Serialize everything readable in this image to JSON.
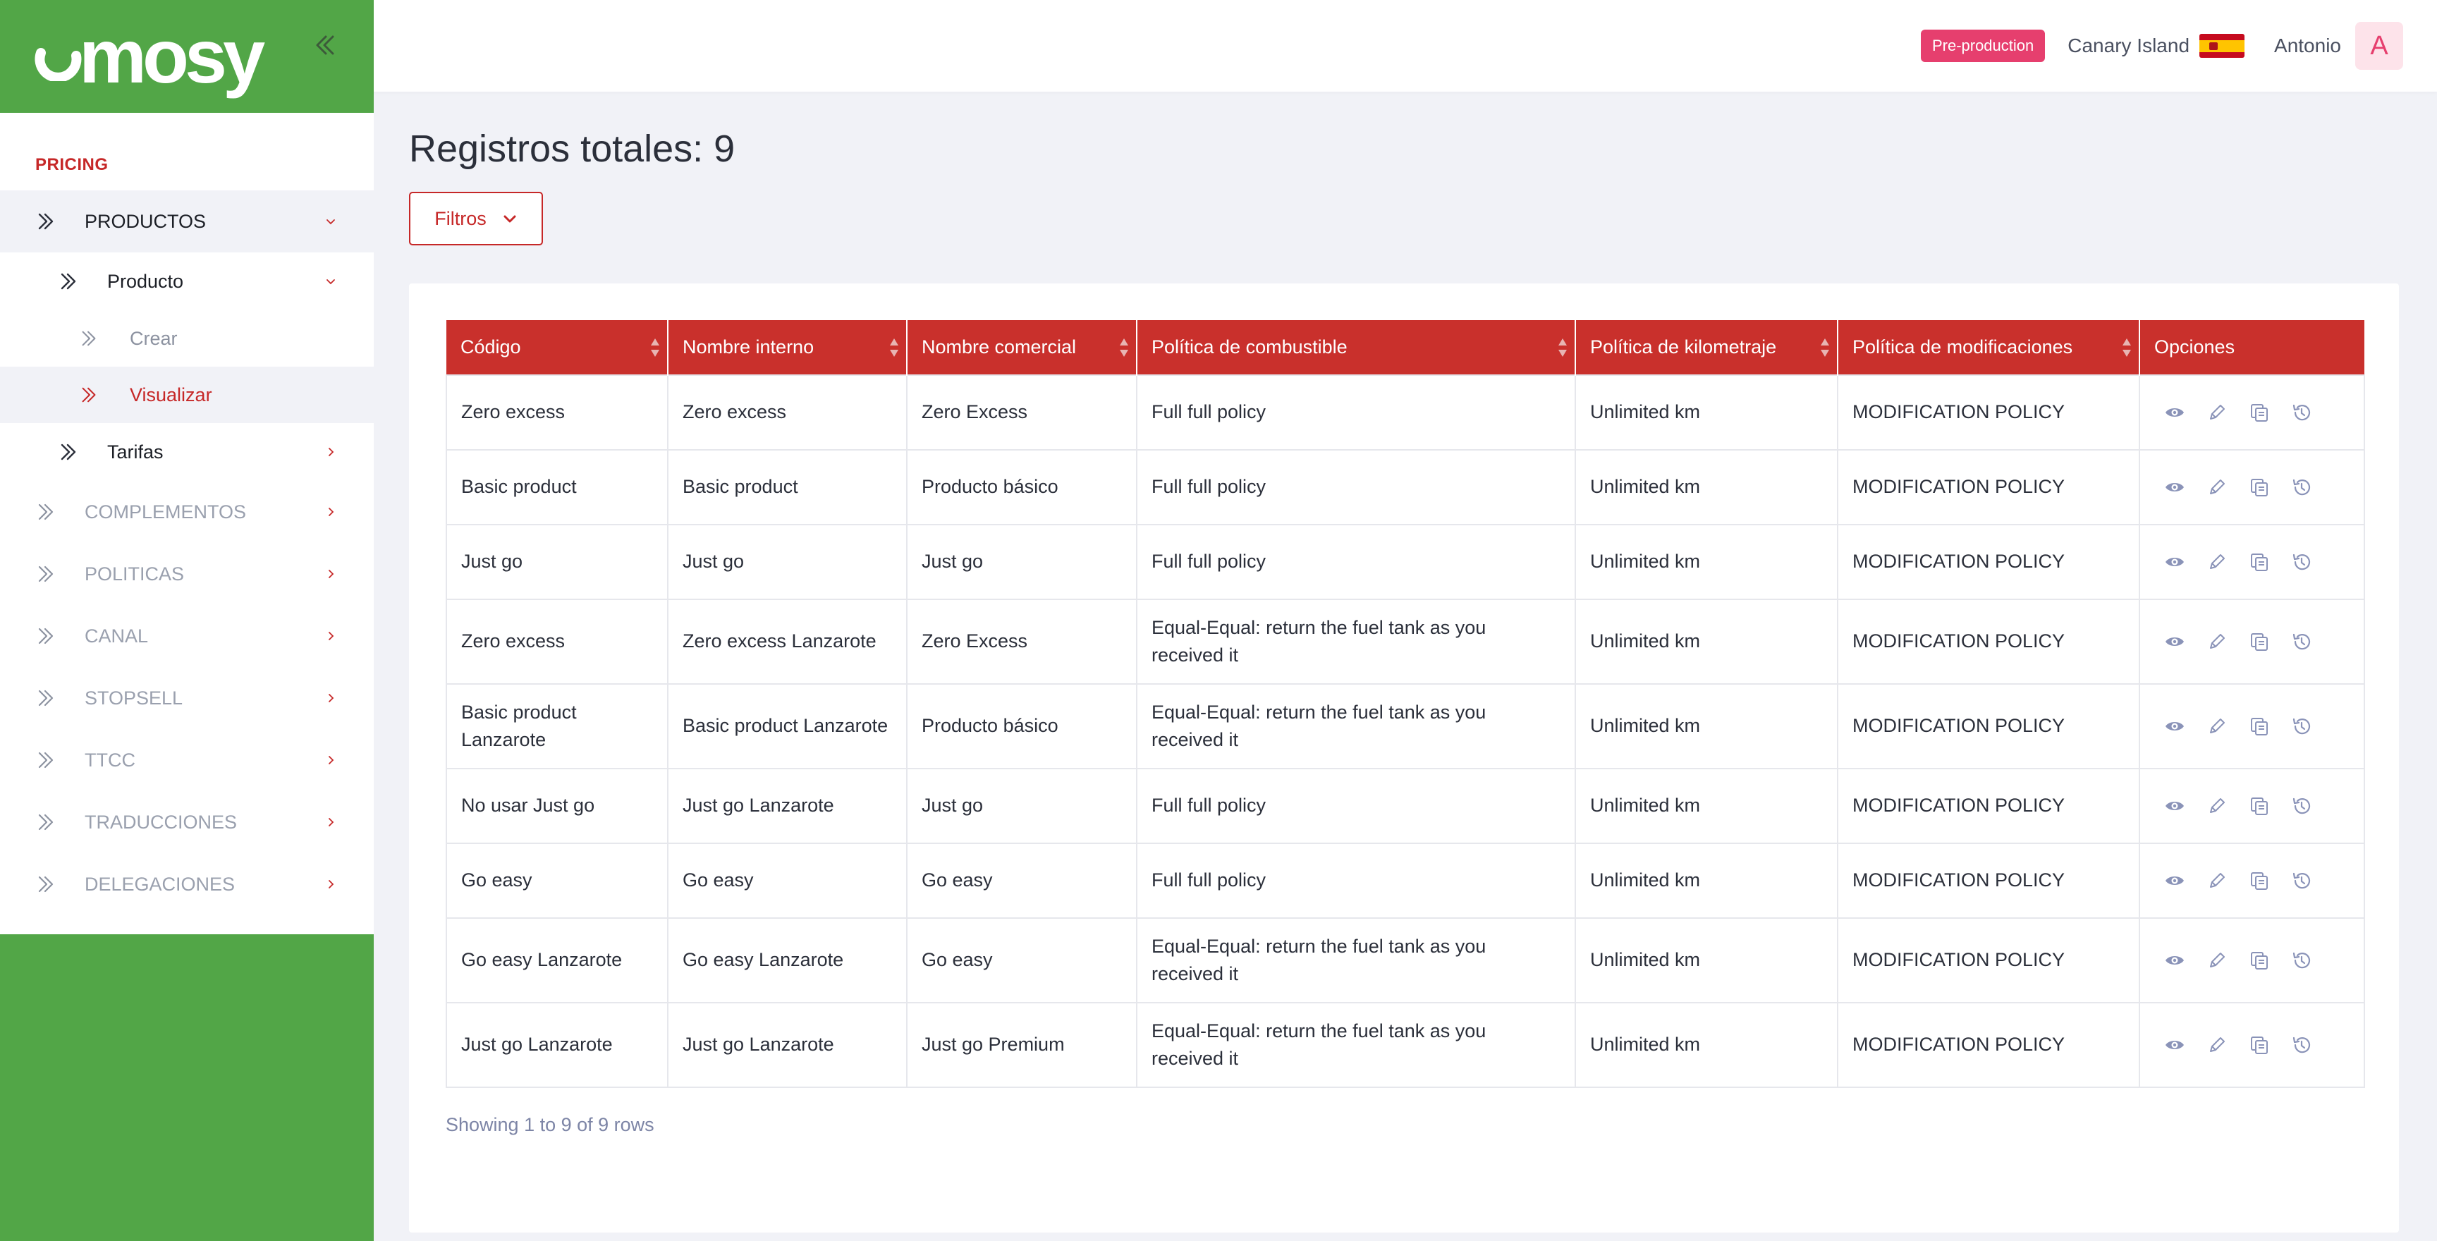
{
  "brand": {
    "logo_text": "mosy"
  },
  "sidebar": {
    "section_title": "PRICING",
    "items": [
      {
        "label": "PRODUCTOS",
        "icon": "double-chevron-right-icon",
        "state": "open"
      },
      {
        "label": "Producto",
        "icon": "double-chevron-right-icon",
        "state": "open"
      },
      {
        "label": "Crear",
        "icon": "double-chevron-right-icon"
      },
      {
        "label": "Visualizar",
        "icon": "double-chevron-right-icon",
        "state": "active"
      },
      {
        "label": "Tarifas",
        "icon": "double-chevron-right-icon"
      },
      {
        "label": "COMPLEMENTOS",
        "icon": "double-chevron-right-icon"
      },
      {
        "label": "POLITICAS",
        "icon": "double-chevron-right-icon"
      },
      {
        "label": "CANAL",
        "icon": "double-chevron-right-icon"
      },
      {
        "label": "STOPSELL",
        "icon": "double-chevron-right-icon"
      },
      {
        "label": "TTCC",
        "icon": "double-chevron-right-icon"
      },
      {
        "label": "TRADUCCIONES",
        "icon": "double-chevron-right-icon"
      },
      {
        "label": "DELEGACIONES",
        "icon": "double-chevron-right-icon"
      }
    ]
  },
  "topbar": {
    "env_badge": "Pre-production",
    "region": "Canary Island",
    "flag": "spain-flag-icon",
    "user_name": "Antonio",
    "avatar_initial": "A"
  },
  "main": {
    "title": "Registros totales: 9",
    "filter_label": "Filtros",
    "footer": "Showing 1 to 9 of 9 rows"
  },
  "table": {
    "columns": [
      "Código",
      "Nombre interno",
      "Nombre comercial",
      "Política de combustible",
      "Política de kilometraje",
      "Política de modificaciones",
      "Opciones"
    ],
    "rows": [
      [
        "Zero excess",
        "Zero excess",
        "Zero Excess",
        "Full full policy",
        "Unlimited km",
        "MODIFICATION POLICY"
      ],
      [
        "Basic product",
        "Basic product",
        "Producto básico",
        "Full full policy",
        "Unlimited km",
        "MODIFICATION POLICY"
      ],
      [
        "Just go",
        "Just go",
        "Just go",
        "Full full policy",
        "Unlimited km",
        "MODIFICATION POLICY"
      ],
      [
        "Zero excess",
        "Zero excess Lanzarote",
        "Zero Excess",
        "Equal-Equal: return the fuel tank as you received it",
        "Unlimited km",
        "MODIFICATION POLICY"
      ],
      [
        "Basic product Lanzarote",
        "Basic product Lanzarote",
        "Producto básico",
        "Equal-Equal: return the fuel tank as you received it",
        "Unlimited km",
        "MODIFICATION POLICY"
      ],
      [
        "No usar Just go",
        "Just go Lanzarote",
        "Just go",
        "Full full policy",
        "Unlimited km",
        "MODIFICATION POLICY"
      ],
      [
        "Go easy",
        "Go easy",
        "Go easy",
        "Full full policy",
        "Unlimited km",
        "MODIFICATION POLICY"
      ],
      [
        "Go easy Lanzarote",
        "Go easy Lanzarote",
        "Go easy",
        "Equal-Equal: return the fuel tank as you received it",
        "Unlimited km",
        "MODIFICATION POLICY"
      ],
      [
        "Just go Lanzarote",
        "Just go Lanzarote",
        "Just go Premium",
        "Equal-Equal: return the fuel tank as you received it",
        "Unlimited km",
        "MODIFICATION POLICY"
      ]
    ],
    "row_actions": [
      "view-icon",
      "edit-icon",
      "copy-icon",
      "history-icon"
    ]
  },
  "colors": {
    "sidebar_green": "#52a647",
    "accent_red": "#c62828",
    "header_red": "#c9302c",
    "badge_pink": "#e63f6e",
    "icon_blue": "#8a93b8"
  }
}
